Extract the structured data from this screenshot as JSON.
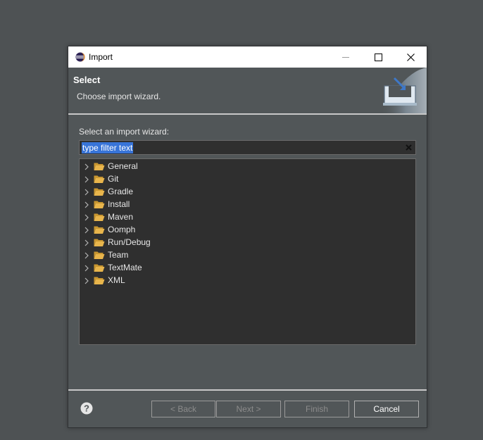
{
  "window": {
    "title": "Import",
    "controls": {
      "minimize": "minimize",
      "maximize": "maximize",
      "close": "close"
    }
  },
  "banner": {
    "title": "Select",
    "description": "Choose import wizard."
  },
  "wizard": {
    "prompt": "Select an import wizard:",
    "filter_value": "type filter text",
    "items": [
      {
        "label": "General"
      },
      {
        "label": "Git"
      },
      {
        "label": "Gradle"
      },
      {
        "label": "Install"
      },
      {
        "label": "Maven"
      },
      {
        "label": "Oomph"
      },
      {
        "label": "Run/Debug"
      },
      {
        "label": "Team"
      },
      {
        "label": "TextMate"
      },
      {
        "label": "XML"
      }
    ]
  },
  "footer": {
    "back": "< Back",
    "next": "Next >",
    "finish": "Finish",
    "cancel": "Cancel"
  },
  "icons": {
    "app": "eclipse-icon",
    "folder": "folder-open-icon",
    "chevron": "chevron-right-icon",
    "help": "help-icon",
    "clear": "clear-icon",
    "banner": "import-wizard-icon"
  },
  "colors": {
    "background": "#4e5254",
    "dialog": "#515658",
    "field": "#2f2f2f",
    "selection": "#3874d8",
    "folder": "#e8b54c"
  }
}
